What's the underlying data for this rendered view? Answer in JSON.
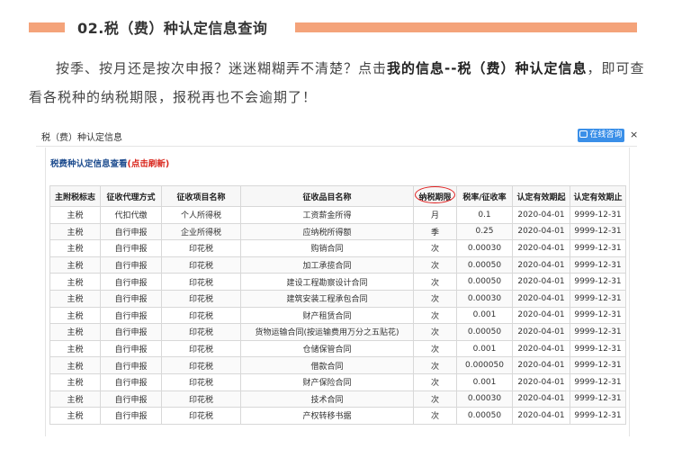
{
  "section": {
    "title": "02.税（费）种认定信息查询"
  },
  "intro": {
    "part1": "按季、按月还是按次申报？迷迷糊糊弄不清楚？点击",
    "bold": "我的信息--税（费）种认定信息",
    "part2": "，即可查看各税种的纳税期限，报税再也不会逾期了！"
  },
  "window": {
    "title": "税（费）种认定信息",
    "online_button": "在线咨询",
    "close": "×"
  },
  "panel": {
    "heading": "税费种认定信息查看",
    "refresh": "(点击刷新)"
  },
  "table": {
    "columns": [
      "主附税标志",
      "征收代理方式",
      "征收项目名称",
      "征收品目名称",
      "纳税期限",
      "税率/征收率",
      "认定有效期起",
      "认定有效期止"
    ],
    "rows": [
      [
        "主税",
        "代扣代缴",
        "个人所得税",
        "工资薪金所得",
        "月",
        "0.1",
        "2020-04-01",
        "9999-12-31"
      ],
      [
        "主税",
        "自行申报",
        "企业所得税",
        "应纳税所得额",
        "季",
        "0.25",
        "2020-04-01",
        "9999-12-31"
      ],
      [
        "主税",
        "自行申报",
        "印花税",
        "购销合同",
        "次",
        "0.00030",
        "2020-04-01",
        "9999-12-31"
      ],
      [
        "主税",
        "自行申报",
        "印花税",
        "加工承揽合同",
        "次",
        "0.00050",
        "2020-04-01",
        "9999-12-31"
      ],
      [
        "主税",
        "自行申报",
        "印花税",
        "建设工程勘察设计合同",
        "次",
        "0.00050",
        "2020-04-01",
        "9999-12-31"
      ],
      [
        "主税",
        "自行申报",
        "印花税",
        "建筑安装工程承包合同",
        "次",
        "0.00030",
        "2020-04-01",
        "9999-12-31"
      ],
      [
        "主税",
        "自行申报",
        "印花税",
        "财产租赁合同",
        "次",
        "0.001",
        "2020-04-01",
        "9999-12-31"
      ],
      [
        "主税",
        "自行申报",
        "印花税",
        "货物运输合同(按运输费用万分之五贴花)",
        "次",
        "0.00050",
        "2020-04-01",
        "9999-12-31"
      ],
      [
        "主税",
        "自行申报",
        "印花税",
        "仓储保管合同",
        "次",
        "0.001",
        "2020-04-01",
        "9999-12-31"
      ],
      [
        "主税",
        "自行申报",
        "印花税",
        "借款合同",
        "次",
        "0.000050",
        "2020-04-01",
        "9999-12-31"
      ],
      [
        "主税",
        "自行申报",
        "印花税",
        "财产保险合同",
        "次",
        "0.001",
        "2020-04-01",
        "9999-12-31"
      ],
      [
        "主税",
        "自行申报",
        "印花税",
        "技术合同",
        "次",
        "0.00030",
        "2020-04-01",
        "9999-12-31"
      ],
      [
        "主税",
        "自行申报",
        "印花税",
        "产权转移书据",
        "次",
        "0.00050",
        "2020-04-01",
        "9999-12-31"
      ]
    ]
  },
  "colors": {
    "accent_bar": "#f4a37a",
    "button_blue": "#3a8fe8",
    "heading_blue": "#1f4d8f",
    "highlight_red": "#e02020"
  }
}
